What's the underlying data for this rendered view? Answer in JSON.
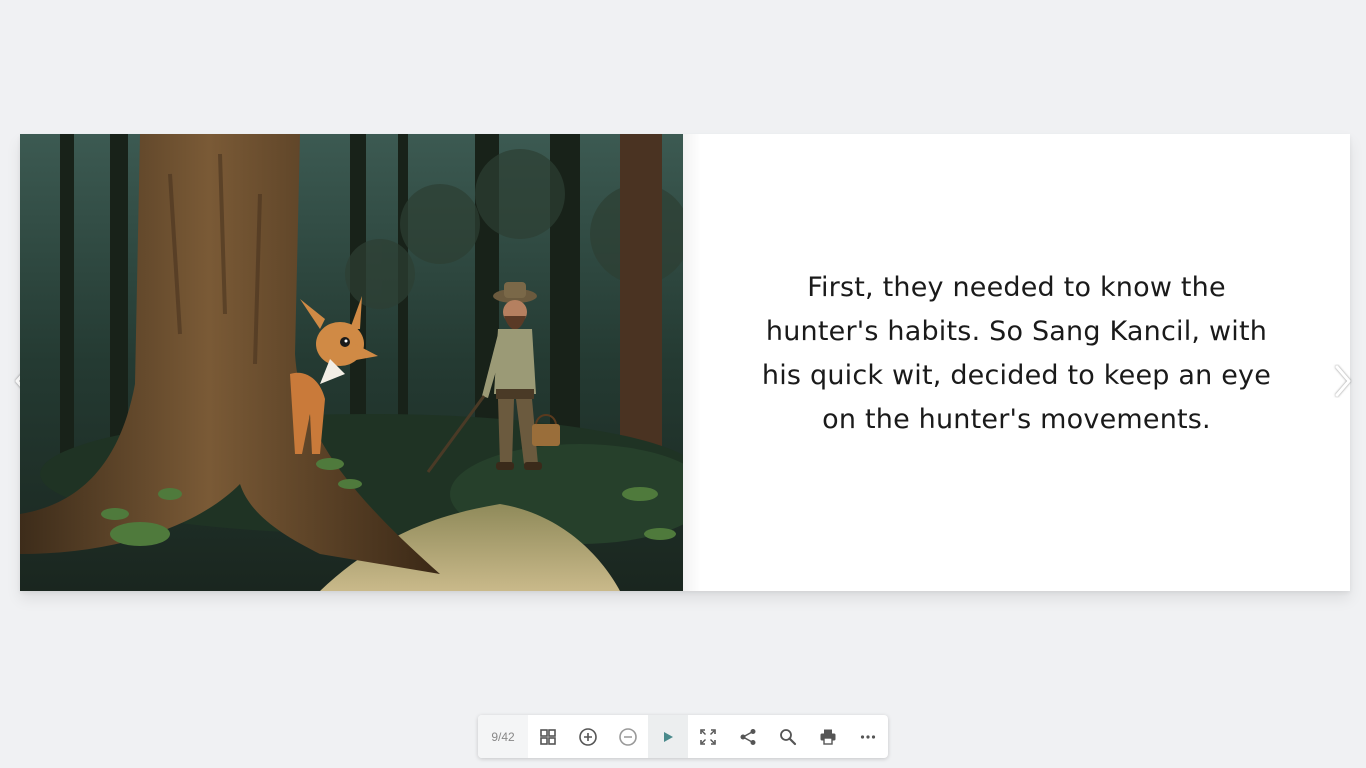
{
  "book": {
    "page_text": "First, they needed to know the hunter's habits. So Sang Kancil, with his quick wit, decided to keep an eye on the hunter's movements.",
    "illustration_alt": "Sang Kancil the mouse deer peeking from behind a tree at a hunter in the forest"
  },
  "navigation": {
    "prev_icon": "chevron-left-icon",
    "next_icon": "chevron-right-icon"
  },
  "toolbar": {
    "page_counter": "9/42",
    "buttons": [
      "thumbnails-icon",
      "zoom-in-icon",
      "zoom-out-icon",
      "play-icon",
      "fullscreen-icon",
      "share-icon",
      "search-icon",
      "print-icon",
      "more-icon"
    ]
  },
  "colors": {
    "background": "#f0f1f3",
    "play_accent": "#4a8a8c",
    "icon": "#555555"
  }
}
